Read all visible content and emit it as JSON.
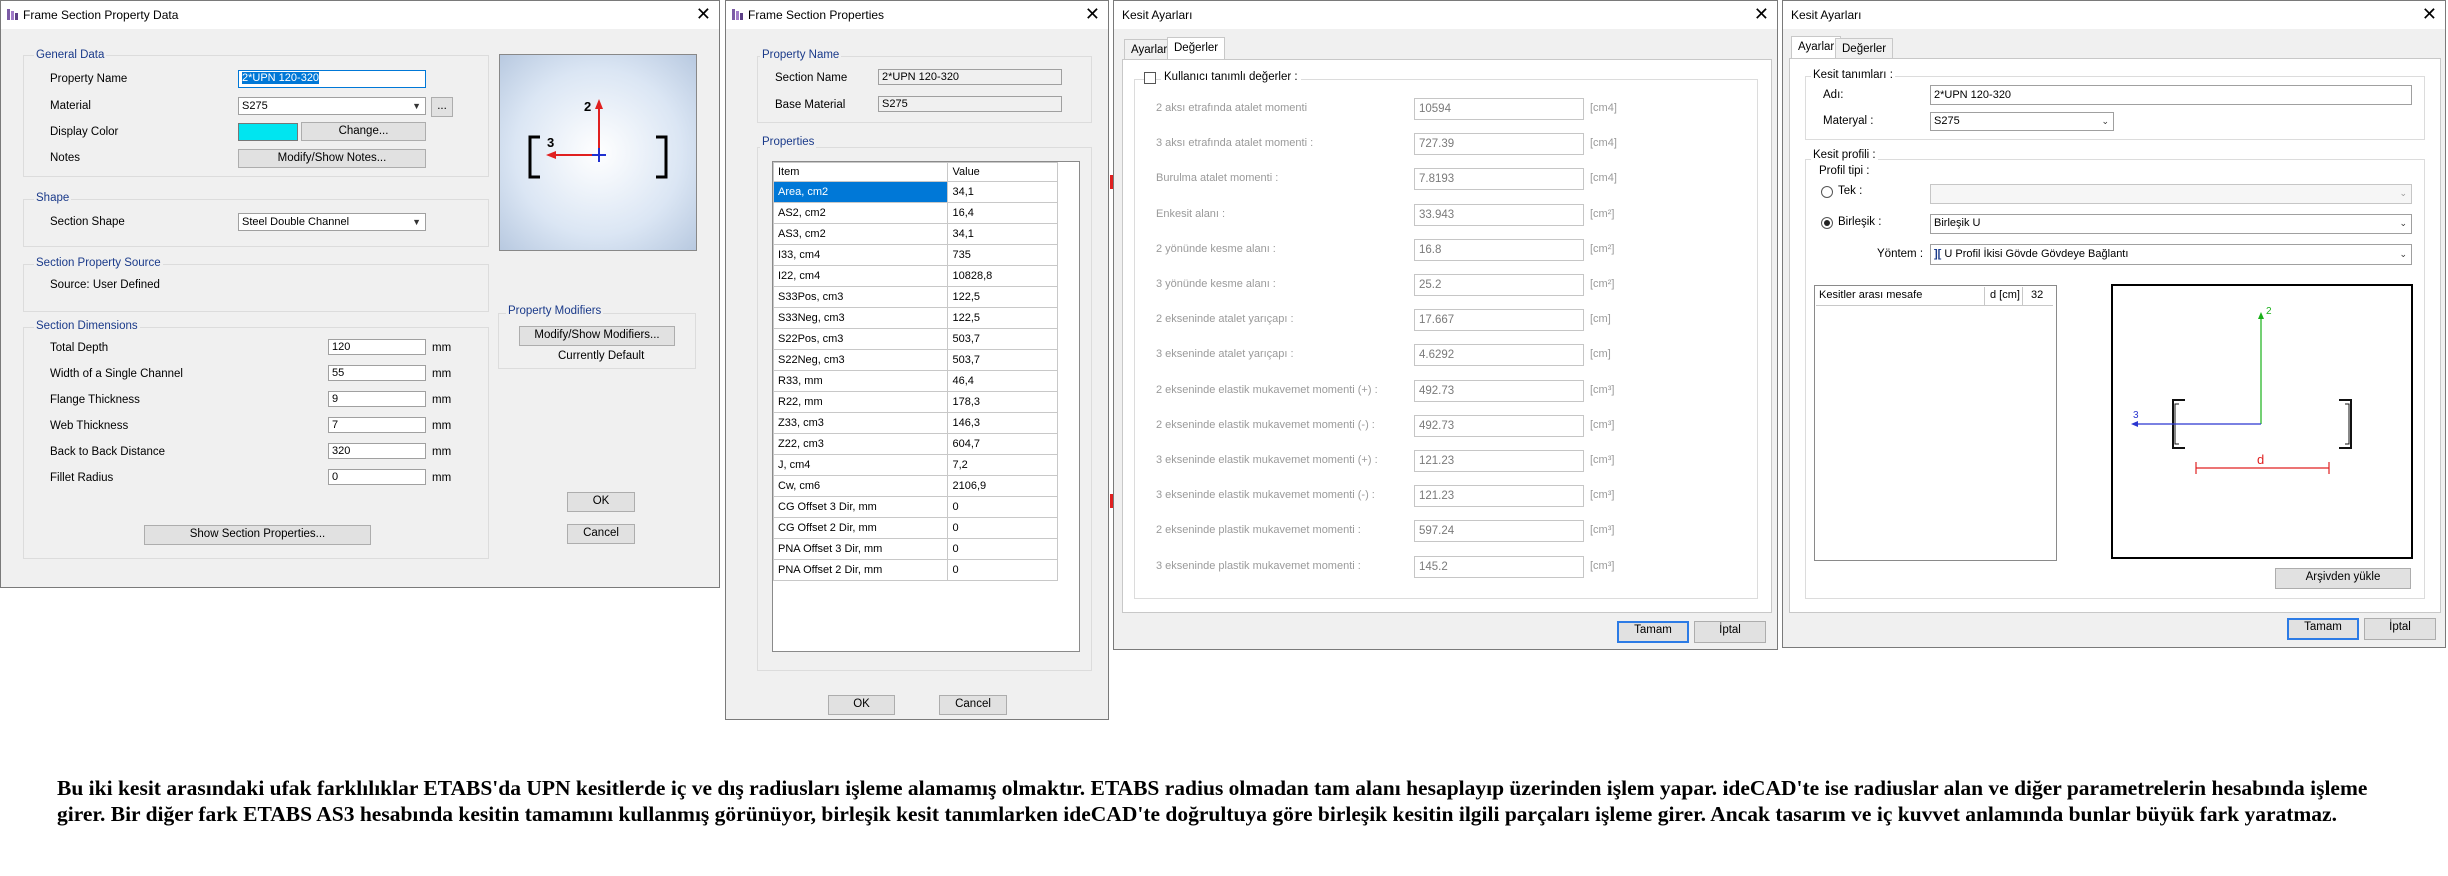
{
  "w1": {
    "title": "Frame Section Property Data",
    "general_data": "General Data",
    "property_name_label": "Property Name",
    "property_name_value": "2*UPN 120-320",
    "material_label": "Material",
    "material_value": "S275",
    "material_more": "...",
    "display_color_label": "Display Color",
    "display_color": "#00e5f0",
    "change_btn": "Change...",
    "notes_label": "Notes",
    "notes_btn": "Modify/Show Notes...",
    "shape_group": "Shape",
    "section_shape_label": "Section Shape",
    "section_shape_value": "Steel Double Channel",
    "source_group": "Section Property Source",
    "source_text": "Source:  User Defined",
    "dims_group": "Section Dimensions",
    "dims": [
      {
        "label": "Total Depth",
        "value": "120",
        "unit": "mm"
      },
      {
        "label": "Width of a Single Channel",
        "value": "55",
        "unit": "mm"
      },
      {
        "label": "Flange Thickness",
        "value": "9",
        "unit": "mm"
      },
      {
        "label": "Web Thickness",
        "value": "7",
        "unit": "mm"
      },
      {
        "label": "Back to Back Distance",
        "value": "320",
        "unit": "mm"
      },
      {
        "label": "Fillet Radius",
        "value": "0",
        "unit": "mm"
      }
    ],
    "show_props_btn": "Show Section Properties...",
    "modifiers_group": "Property Modifiers",
    "modifiers_btn": "Modify/Show Modifiers...",
    "currently_default": "Currently Default",
    "ok": "OK",
    "cancel": "Cancel",
    "preview_axis2": "2",
    "preview_axis3": "3"
  },
  "w2": {
    "title": "Frame Section Properties",
    "property_name_group": "Property Name",
    "section_name_label": "Section Name",
    "section_name_value": "2*UPN 120-320",
    "base_material_label": "Base Material",
    "base_material_value": "S275",
    "properties_group": "Properties",
    "col_item": "Item",
    "col_value": "Value",
    "rows": [
      {
        "item": "Area, cm2",
        "value": "34,1"
      },
      {
        "item": "AS2, cm2",
        "value": "16,4"
      },
      {
        "item": "AS3, cm2",
        "value": "34,1"
      },
      {
        "item": "I33, cm4",
        "value": "735"
      },
      {
        "item": "I22, cm4",
        "value": "10828,8"
      },
      {
        "item": "S33Pos, cm3",
        "value": "122,5"
      },
      {
        "item": "S33Neg, cm3",
        "value": "122,5"
      },
      {
        "item": "S22Pos, cm3",
        "value": "503,7"
      },
      {
        "item": "S22Neg, cm3",
        "value": "503,7"
      },
      {
        "item": "R33, mm",
        "value": "46,4"
      },
      {
        "item": "R22, mm",
        "value": "178,3"
      },
      {
        "item": "Z33, cm3",
        "value": "146,3"
      },
      {
        "item": "Z22, cm3",
        "value": "604,7"
      },
      {
        "item": "J, cm4",
        "value": "7,2"
      },
      {
        "item": "Cw, cm6",
        "value": "2106,9"
      },
      {
        "item": "CG Offset 3 Dir, mm",
        "value": "0"
      },
      {
        "item": "CG Offset 2 Dir, mm",
        "value": "0"
      },
      {
        "item": "PNA Offset 3 Dir, mm",
        "value": "0"
      },
      {
        "item": "PNA Offset 2 Dir, mm",
        "value": "0"
      }
    ],
    "ok": "OK",
    "cancel": "Cancel"
  },
  "w3": {
    "title": "Kesit Ayarları",
    "tab1": "Ayarlar",
    "tab2": "Değerler",
    "user_defined": "Kullanıcı tanımlı değerler :",
    "rows": [
      {
        "label": "2 aksı etrafında atalet momenti",
        "value": "10594",
        "unit": "[cm4]"
      },
      {
        "label": "3 aksı etrafında atalet momenti :",
        "value": "727.39",
        "unit": "[cm4]"
      },
      {
        "label": "Burulma atalet momenti :",
        "value": "7.8193",
        "unit": "[cm4]"
      },
      {
        "label": "Enkesit alanı :",
        "value": "33.943",
        "unit": "[cm²]"
      },
      {
        "label": "2 yönünde kesme alanı :",
        "value": "16.8",
        "unit": "[cm²]"
      },
      {
        "label": "3 yönünde kesme alanı :",
        "value": "25.2",
        "unit": "[cm²]"
      },
      {
        "label": "2 ekseninde atalet yarıçapı :",
        "value": "17.667",
        "unit": "[cm]"
      },
      {
        "label": "3 ekseninde atalet yarıçapı :",
        "value": "4.6292",
        "unit": "[cm]"
      },
      {
        "label": "2 ekseninde elastik mukavemet momenti (+) :",
        "value": "492.73",
        "unit": "[cm³]"
      },
      {
        "label": "2 ekseninde elastik mukavemet momenti (-) :",
        "value": "492.73",
        "unit": "[cm³]"
      },
      {
        "label": "3 ekseninde elastik mukavemet momenti (+) :",
        "value": "121.23",
        "unit": "[cm³]"
      },
      {
        "label": "3 ekseninde elastik mukavemet momenti (-) :",
        "value": "121.23",
        "unit": "[cm³]"
      },
      {
        "label": "2 ekseninde plastik mukavemet momenti :",
        "value": "597.24",
        "unit": "[cm³]"
      },
      {
        "label": "3 ekseninde plastik mukavemet momenti :",
        "value": "145.2",
        "unit": "[cm³]"
      }
    ],
    "ok": "Tamam",
    "cancel": "İptal"
  },
  "w4": {
    "title": "Kesit Ayarları",
    "tab1": "Ayarlar",
    "tab2": "Değerler",
    "defs_group": "Kesit tanımları :",
    "name_label": "Adı:",
    "name_value": "2*UPN 120-320",
    "material_label": "Materyal :",
    "material_value": "S275",
    "profile_group": "Kesit profili :",
    "profile_type": "Profil tipi :",
    "single_label": "Tek :",
    "composite_label": "Birleşik :",
    "composite_value": "Birleşik U",
    "method_label": "Yöntem :",
    "method_value": "U Profil İkisi Gövde Gövdeye Bağlantı",
    "grid_col1": "Kesitler arası mesafe",
    "grid_col2": "d [cm]",
    "grid_val": "32",
    "load_btn": "Arşivden yükle",
    "ok": "Tamam",
    "cancel": "İptal",
    "diag_axis2": "2",
    "diag_axis3": "3",
    "diag_d": "d"
  },
  "caption": "Bu iki kesit arasındaki ufak farklılıklar ETABS'da UPN kesitlerde iç ve dış radiusları işleme alamamış olmaktır. ETABS radius olmadan tam alanı hesaplayıp üzerinden işlem yapar. ideCAD'te ise radiuslar alan ve diğer parametrelerin hesabında işleme girer. Bir diğer fark ETABS AS3 hesabında kesitin tamamını kullanmış görünüyor, birleşik kesit tanımlarken ideCAD'te doğrultuya göre birleşik kesitin ilgili parçaları işleme girer. Ancak tasarım ve iç kuvvet anlamında bunlar büyük fark yaratmaz."
}
